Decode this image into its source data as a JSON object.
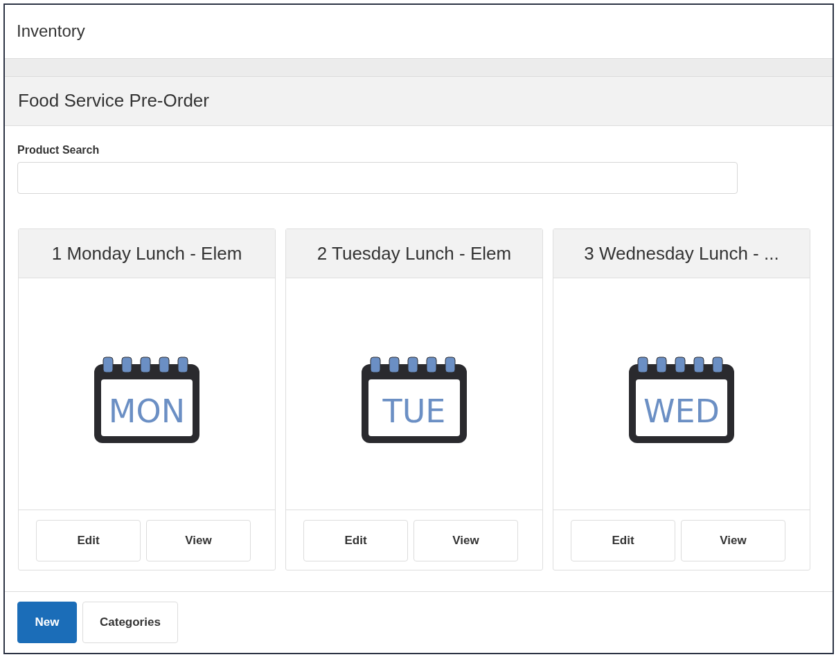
{
  "page": {
    "title": "Inventory"
  },
  "section": {
    "title": "Food Service Pre-Order"
  },
  "search": {
    "label": "Product Search"
  },
  "products": [
    {
      "title": "1 Monday Lunch - Elem",
      "icon_label": "MON",
      "buttons": [
        "Edit",
        "View"
      ]
    },
    {
      "title": "2 Tuesday Lunch - Elem",
      "icon_label": "TUE",
      "buttons": [
        "Edit",
        "View"
      ]
    },
    {
      "title": "3 Wednesday Lunch - ...",
      "icon_label": "WED",
      "buttons": [
        "Edit",
        "View"
      ]
    }
  ],
  "footer_buttons": [
    {
      "label": "New",
      "kind": "primary"
    },
    {
      "label": "Categories",
      "kind": "default"
    }
  ]
}
